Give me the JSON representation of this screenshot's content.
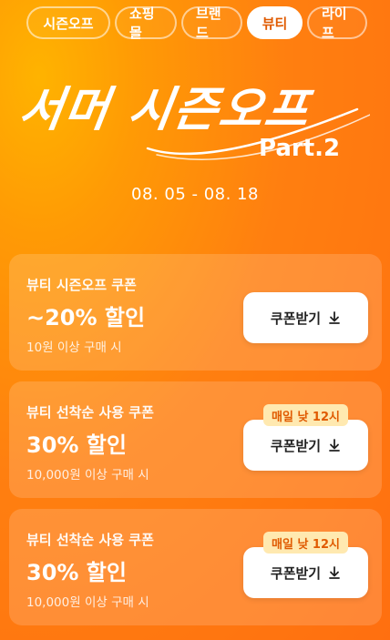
{
  "tabs": [
    {
      "label": "시즌오프",
      "active": false
    },
    {
      "label": "쇼핑몰",
      "active": false
    },
    {
      "label": "브랜드",
      "active": false
    },
    {
      "label": "뷰티",
      "active": true
    },
    {
      "label": "라이프",
      "active": false
    }
  ],
  "hero": {
    "title": "서머 시즌오프",
    "part": "Part.2",
    "dates": "08. 05 - 08. 18"
  },
  "coupons": [
    {
      "name": "뷰티 시즌오프 쿠폰",
      "discount": "~20% 할인",
      "condition": "10원 이상 구매 시",
      "button": "쿠폰받기",
      "badge": ""
    },
    {
      "name": "뷰티 선착순 사용 쿠폰",
      "discount": "30% 할인",
      "condition": "10,000원 이상 구매 시",
      "button": "쿠폰받기",
      "badge": "매일 낮 12시"
    },
    {
      "name": "뷰티 선착순 사용 쿠폰",
      "discount": "30% 할인",
      "condition": "10,000원 이상 구매 시",
      "button": "쿠폰받기",
      "badge": "매일 낮 12시"
    }
  ],
  "icons": {
    "download": "download-arrow-icon"
  },
  "colors": {
    "accent": "#ff7a12",
    "badge_bg": "#ffe9b0",
    "badge_text": "#e05a00"
  }
}
